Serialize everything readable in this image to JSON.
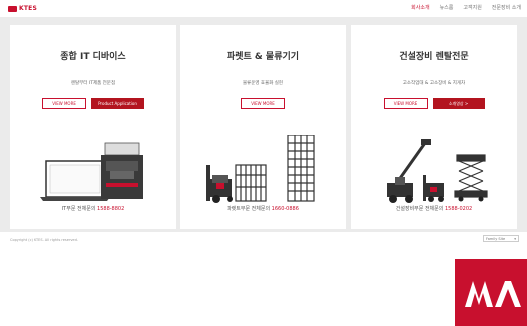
{
  "header": {
    "logo_text": "KTES",
    "nav": [
      "회사소개",
      "뉴스룸",
      "고객지원",
      "전문장비 소개"
    ]
  },
  "cards": [
    {
      "title": "종합 IT 디바이스",
      "subtitle": "렌탈부터 IT제품 전문점",
      "buttons": [
        "VIEW MORE",
        "Product Application"
      ],
      "tel_label": "IT부문 전체문의",
      "tel_number": "1588-8802"
    },
    {
      "title": "파렛트 & 물류기기",
      "subtitle": "물류운영 효율화 실현",
      "buttons": [
        "VIEW MORE"
      ],
      "tel_label": "파렛트부문 전체문의",
      "tel_number": "1660-0886"
    },
    {
      "title": "건설장비 렌탈전문",
      "subtitle": "고소작업대 & 고소장비 & 지게차",
      "buttons": [
        "VIEW MORE",
        "소개영상 >"
      ],
      "tel_label": "건설장비부문 전체문의",
      "tel_number": "1588-0202"
    }
  ],
  "footer": {
    "copyright": "Copyright (c) KTES. All rights reserved.",
    "select_value": "Family Site"
  },
  "colors": {
    "accent": "#c8102e",
    "button_fill": "#b3141f",
    "panel_bg": "#ebebeb"
  }
}
